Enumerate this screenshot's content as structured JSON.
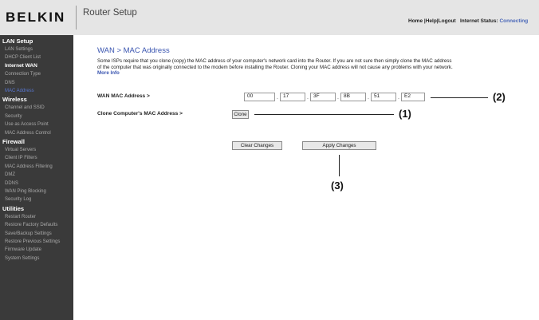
{
  "header": {
    "logo": "BELKIN",
    "title": "Router Setup",
    "links": [
      "Home",
      "Help",
      "Logout"
    ],
    "internet_status_label": "Internet Status:",
    "internet_status_value": "Connecting"
  },
  "sidebar": {
    "items": [
      {
        "label": "LAN Setup",
        "kind": "section"
      },
      {
        "label": "LAN Settings",
        "kind": "item"
      },
      {
        "label": "DHCP Client List",
        "kind": "item"
      },
      {
        "label": "Internet WAN",
        "kind": "subhead"
      },
      {
        "label": "Connection Type",
        "kind": "item"
      },
      {
        "label": "DNS",
        "kind": "item"
      },
      {
        "label": "MAC Address",
        "kind": "current"
      },
      {
        "label": "Wireless",
        "kind": "section"
      },
      {
        "label": "Channel and SSID",
        "kind": "item"
      },
      {
        "label": "Security",
        "kind": "item"
      },
      {
        "label": "Use as Access Point",
        "kind": "item"
      },
      {
        "label": "MAC Address Control",
        "kind": "item"
      },
      {
        "label": "Firewall",
        "kind": "section"
      },
      {
        "label": "Virtual Servers",
        "kind": "item"
      },
      {
        "label": "Client IP Filters",
        "kind": "item"
      },
      {
        "label": "MAC Address Filtering",
        "kind": "item"
      },
      {
        "label": "DMZ",
        "kind": "item"
      },
      {
        "label": "DDNS",
        "kind": "item"
      },
      {
        "label": "WAN Ping Blocking",
        "kind": "item"
      },
      {
        "label": "Security Log",
        "kind": "item"
      },
      {
        "label": "Utilities",
        "kind": "section"
      },
      {
        "label": "Restart Router",
        "kind": "item"
      },
      {
        "label": "Restore Factory Defaults",
        "kind": "item"
      },
      {
        "label": "Save/Backup Settings",
        "kind": "item"
      },
      {
        "label": "Restore Previous Settings",
        "kind": "item"
      },
      {
        "label": "Firmware Update",
        "kind": "item"
      },
      {
        "label": "System Settings",
        "kind": "item"
      }
    ]
  },
  "main": {
    "title": "WAN > MAC Address",
    "description": "Some ISPs require that you clone (copy) the MAC address of your computer's network card into the Router. If you are not sure then simply clone the MAC address of the computer that was originally connected to the modem before installing the Router. Cloning your MAC address will not cause any problems with your network.",
    "more_info": "More Info",
    "wan_mac_label": "WAN MAC Address >",
    "wan_mac_octets": [
      "00",
      "17",
      "3F",
      "8B",
      "51",
      "E2"
    ],
    "clone_label": "Clone Computer's MAC Address >",
    "clone_button": "Clone",
    "clear_button": "Clear Changes",
    "apply_button": "Apply Changes"
  },
  "callouts": {
    "c1": "(1)",
    "c2": "(2)",
    "c3": "(3)"
  }
}
